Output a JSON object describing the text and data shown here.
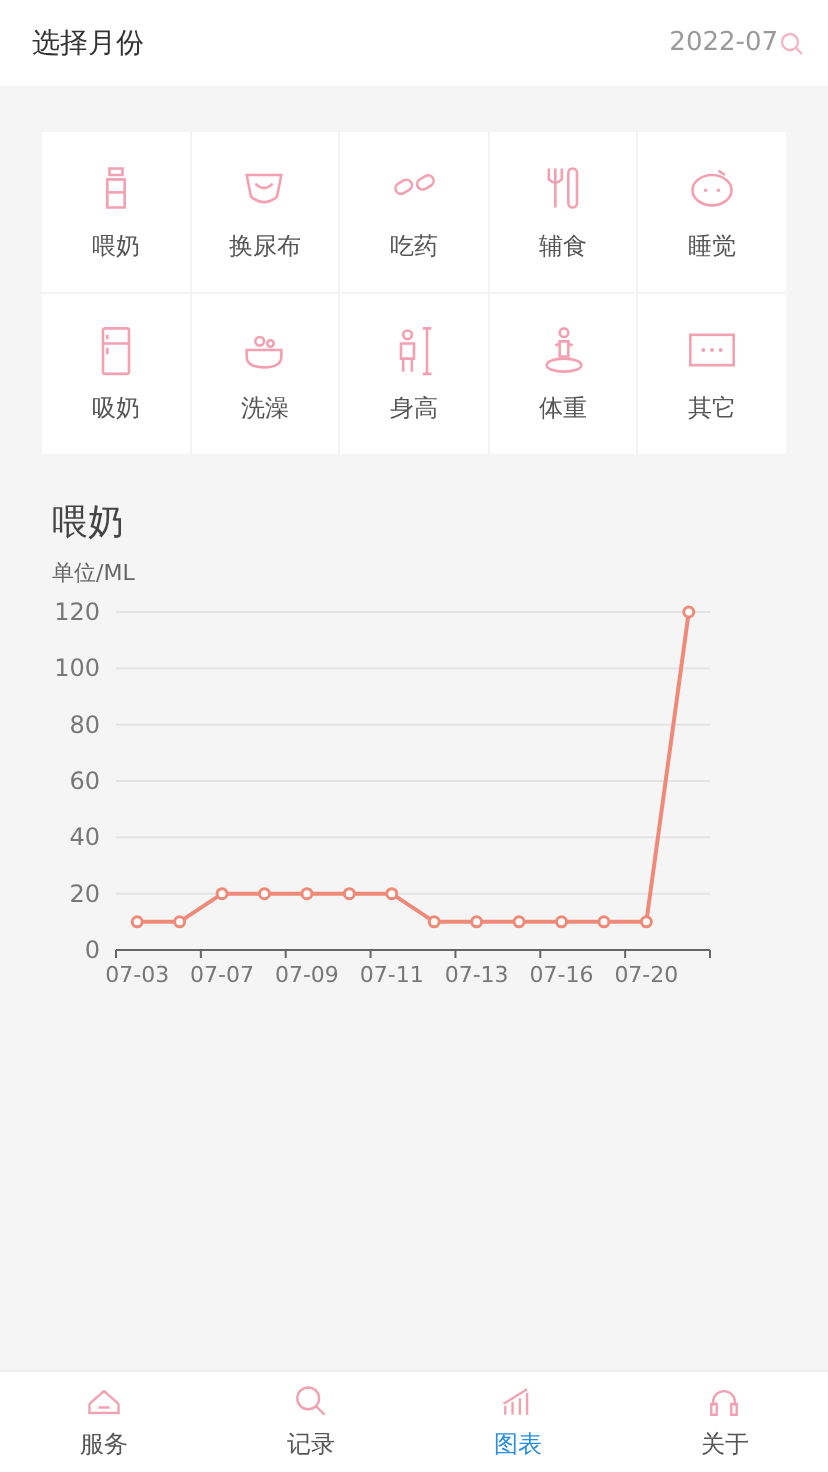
{
  "header": {
    "title": "选择月份",
    "month": "2022-07"
  },
  "categories": [
    {
      "label": "喂奶"
    },
    {
      "label": "换尿布"
    },
    {
      "label": "吃药"
    },
    {
      "label": "辅食"
    },
    {
      "label": "睡觉"
    },
    {
      "label": "吸奶"
    },
    {
      "label": "洗澡"
    },
    {
      "label": "身高"
    },
    {
      "label": "体重"
    },
    {
      "label": "其它"
    }
  ],
  "chart": {
    "title": "喂奶",
    "unit": "单位/ML",
    "chart_data": {
      "type": "line",
      "categories": [
        "07-03",
        null,
        "07-07",
        null,
        "07-09",
        null,
        "07-11",
        null,
        "07-13",
        null,
        "07-16",
        null,
        "07-20",
        null
      ],
      "grid": true,
      "series": [
        {
          "color": "#f08a78",
          "marker": "circle",
          "values": [
            10,
            10,
            20,
            20,
            20,
            20,
            20,
            10,
            10,
            10,
            10,
            10,
            10,
            120
          ]
        }
      ],
      "ylim": [
        0,
        120
      ],
      "yticks": [
        0,
        20,
        40,
        60,
        80,
        100,
        120
      ]
    }
  },
  "tabbar": [
    {
      "label": "服务",
      "selected": false
    },
    {
      "label": "记录",
      "selected": false
    },
    {
      "label": "图表",
      "selected": true
    },
    {
      "label": "关于",
      "selected": false
    }
  ]
}
